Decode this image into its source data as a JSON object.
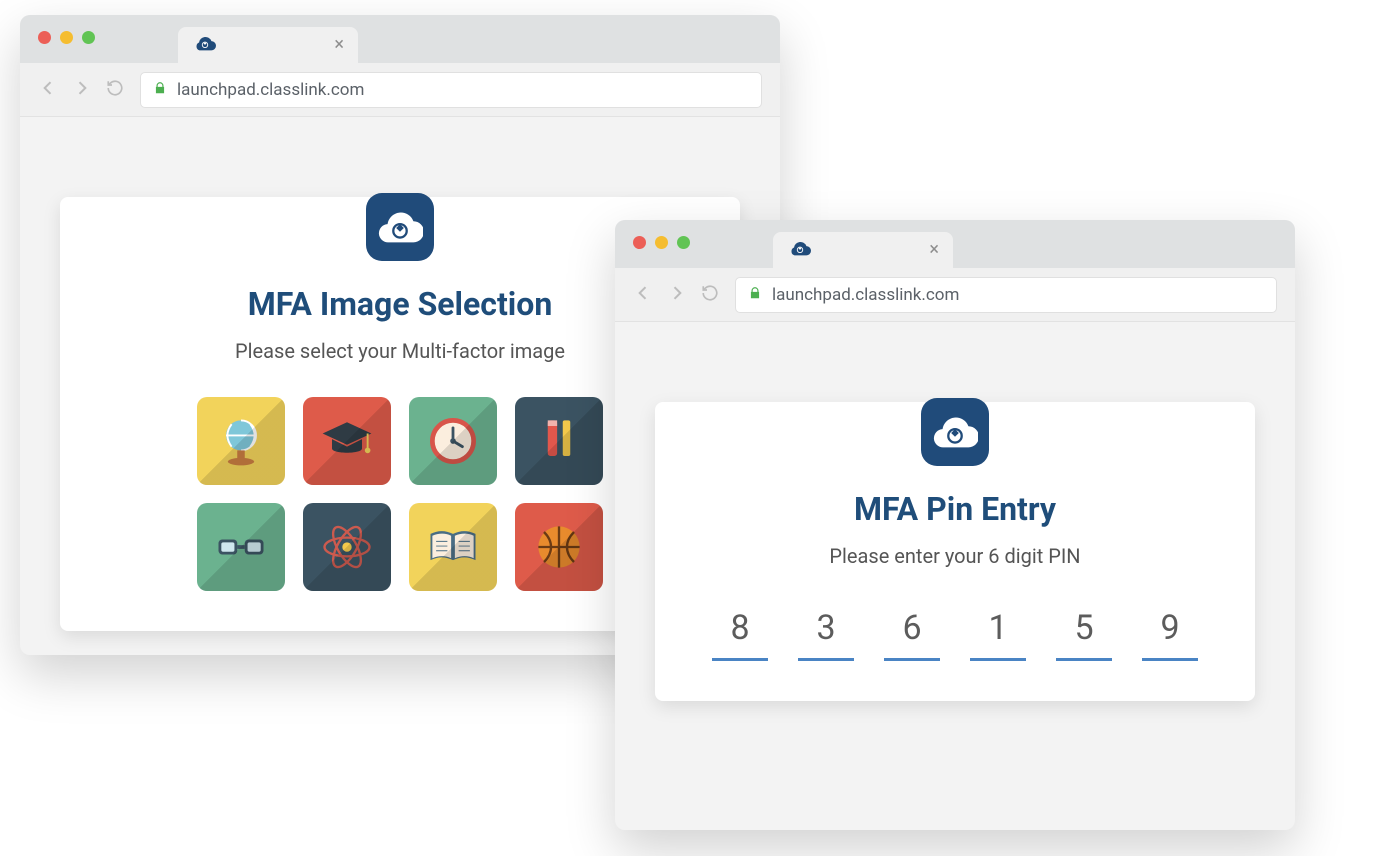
{
  "colors": {
    "brand": "#204b7a",
    "title": "#1f4d7a",
    "pin_line": "#4a84c4",
    "lock": "#4caf50"
  },
  "browser": {
    "url": "launchpad.classlink.com",
    "tab_icon": "classlink-cloud-icon",
    "tab_close": "×"
  },
  "window1": {
    "card": {
      "title": "MFA Image Selection",
      "subtitle": "Please select your Multi-factor image",
      "tiles": [
        {
          "name": "globe",
          "bg": "#f2d35b"
        },
        {
          "name": "graduation",
          "bg": "#de5b4a"
        },
        {
          "name": "clock",
          "bg": "#6bb28f"
        },
        {
          "name": "pencils",
          "bg": "#3b5362"
        },
        {
          "name": "glasses",
          "bg": "#6bb28f"
        },
        {
          "name": "atom",
          "bg": "#3b5362"
        },
        {
          "name": "book",
          "bg": "#f2d35b"
        },
        {
          "name": "basketball",
          "bg": "#de5b4a"
        }
      ]
    }
  },
  "window2": {
    "card": {
      "title": "MFA Pin Entry",
      "subtitle": "Please enter your 6 digit PIN",
      "pin": [
        "8",
        "3",
        "6",
        "1",
        "5",
        "9"
      ]
    }
  }
}
